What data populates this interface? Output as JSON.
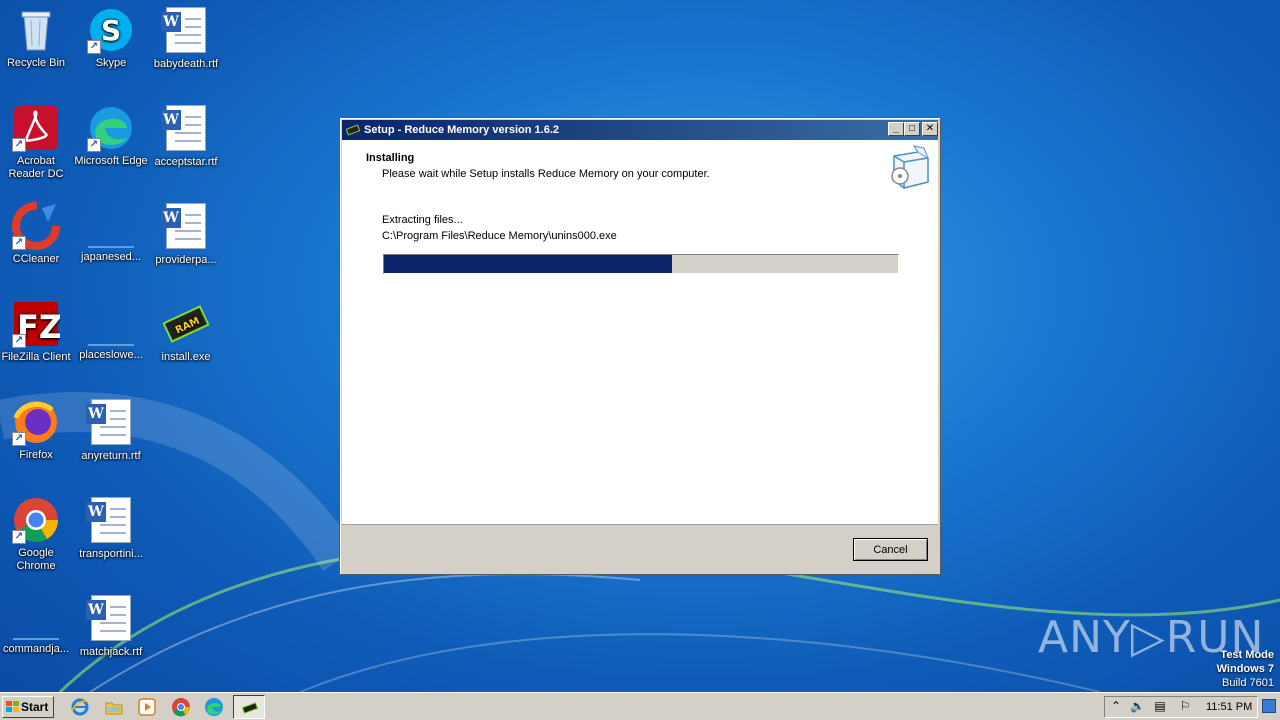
{
  "desktop": {
    "icons": [
      {
        "label": "Recycle Bin",
        "icon": "recycle-bin-icon"
      },
      {
        "label": "Skype",
        "icon": "skype-icon"
      },
      {
        "label": "babydeath.rtf",
        "icon": "word-document-icon"
      },
      {
        "label": "Acrobat Reader DC",
        "icon": "acrobat-icon"
      },
      {
        "label": "Microsoft Edge",
        "icon": "edge-icon"
      },
      {
        "label": "acceptstar.rtf",
        "icon": "word-document-icon"
      },
      {
        "label": "CCleaner",
        "icon": "ccleaner-icon"
      },
      {
        "label": "japanesed...",
        "icon": "blank-file-icon"
      },
      {
        "label": "providerpa...",
        "icon": "word-document-icon"
      },
      {
        "label": "FileZilla Client",
        "icon": "filezilla-icon"
      },
      {
        "label": "placeslowe...",
        "icon": "blank-file-icon"
      },
      {
        "label": "install.exe",
        "icon": "ram-chip-icon"
      },
      {
        "label": "Firefox",
        "icon": "firefox-icon"
      },
      {
        "label": "anyreturn.rtf",
        "icon": "word-document-icon"
      },
      {
        "label": "Google Chrome",
        "icon": "chrome-icon"
      },
      {
        "label": "transportini...",
        "icon": "word-document-icon"
      },
      {
        "label": "commandja...",
        "icon": "blank-file-icon"
      },
      {
        "label": "matchjack.rtf",
        "icon": "word-document-icon"
      }
    ]
  },
  "setup": {
    "title": "Setup - Reduce Memory version 1.6.2",
    "header_title": "Installing",
    "header_subtitle": "Please wait while Setup installs Reduce Memory on your computer.",
    "status_text": "Extracting files...",
    "current_file": "C:\\Program Files\\Reduce Memory\\unins000.exe",
    "progress_fraction": 0.56,
    "cancel_label": "Cancel",
    "minimize_glyph": "_",
    "maximize_glyph": "□",
    "close_glyph": "✕"
  },
  "watermark": {
    "brand": "ANY▷RUN",
    "test_mode": "Test Mode",
    "os": "Windows 7",
    "build": "Build 7601"
  },
  "taskbar": {
    "start_label": "Start",
    "clock": "11:51 PM",
    "pinned": [
      "internet-explorer-icon",
      "explorer-folder-icon",
      "media-player-icon",
      "chrome-icon",
      "edge-icon",
      "ram-chip-icon"
    ]
  },
  "colors": {
    "titlebar_start": "#0a246a",
    "titlebar_end": "#3a6ea5",
    "progress_fill": "#0a246a",
    "desktop_bg": "#1a78d0"
  }
}
